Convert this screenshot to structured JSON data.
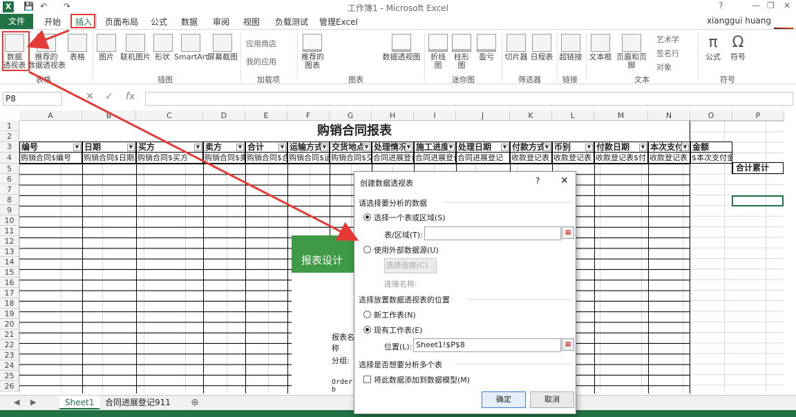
{
  "window": {
    "title": "工作簿1 - Microsoft Excel",
    "help": "?",
    "user": "xianggui huang",
    "min": "—",
    "restore": "❐",
    "close": "✕"
  },
  "qat": {
    "save": "💾",
    "undo": "↶",
    "redo": "↷"
  },
  "tabs": [
    {
      "label": "文件"
    },
    {
      "label": "开始"
    },
    {
      "label": "插入"
    },
    {
      "label": "页面布局"
    },
    {
      "label": "公式"
    },
    {
      "label": "数据"
    },
    {
      "label": "审阅"
    },
    {
      "label": "视图"
    },
    {
      "label": "负载测试"
    },
    {
      "label": "管理Excel"
    }
  ],
  "ribbon": {
    "buttons": [
      {
        "label": "数据\n透视表"
      },
      {
        "label": "推荐的\n数据透视表"
      },
      {
        "label": "表格"
      },
      {
        "label": "图片"
      },
      {
        "label": "联机图片"
      },
      {
        "label": "形状"
      },
      {
        "label": "SmartArt"
      },
      {
        "label": "屏幕截图"
      },
      {
        "label": "推荐的\n图表"
      },
      {
        "label": "数据透视图"
      },
      {
        "label": "折线图"
      },
      {
        "label": "柱形图"
      },
      {
        "label": "盈亏"
      },
      {
        "label": "切片器"
      },
      {
        "label": "日程表"
      },
      {
        "label": "超链接"
      },
      {
        "label": "文本框"
      },
      {
        "label": "页眉和页脚"
      },
      {
        "label": "公式"
      },
      {
        "label": "符号"
      }
    ],
    "small": {
      "store": "应用商店",
      "myapps": "我的应用",
      "art": "艺术字",
      "sign": "签名行",
      "obj": "对象"
    },
    "groups": {
      "table": "表格",
      "illus": "插图",
      "addins": "加载项",
      "charts": "图表",
      "spark": "迷你图",
      "filter": "筛选器",
      "link": "链接",
      "text": "文本",
      "symbol": "符号"
    }
  },
  "formula": {
    "namebox": "P8",
    "cancel": "✕",
    "enter": "✓",
    "fx": "fx"
  },
  "columns": [
    "A",
    "B",
    "C",
    "D",
    "E",
    "F",
    "G",
    "H",
    "I",
    "J",
    "K",
    "L",
    "M",
    "N",
    "O",
    "P"
  ],
  "rows": [
    "1",
    "2",
    "3",
    "4",
    "5",
    "6",
    "7",
    "8",
    "9",
    "10",
    "11",
    "12",
    "13",
    "14",
    "15",
    "16",
    "17",
    "18",
    "19",
    "20",
    "21",
    "22",
    "23",
    "24",
    "25",
    "26"
  ],
  "sheet": {
    "title": "购销合同报表",
    "headers": [
      "编号",
      "日期",
      "买方",
      "卖方",
      "合计",
      "运输方式",
      "交货地点",
      "处理情况",
      "施工进度",
      "处理日期",
      "付款方式",
      "币别",
      "付款日期",
      "本次支付",
      "金额"
    ],
    "fields": [
      "购销合同$编号",
      "购销合同$日期",
      "购销合同$买方",
      "购销合同$卖方",
      "购销合同$合计",
      "购销合同$运输",
      "购销合同$交货",
      "合同进展登记",
      "合同进展登记",
      "合同进展登记",
      "收款登记表",
      "收款登记表",
      "收款登记表$付",
      "收款登记表",
      "$本次支付金额"
    ],
    "total": "合计累计"
  },
  "panel": {
    "title": "报表设计",
    "name": "报表名称",
    "group": "分组:",
    "order": "Order b"
  },
  "sheettabs": [
    {
      "label": "Sheet1"
    },
    {
      "label": "合同进展登记911"
    }
  ],
  "dialog": {
    "title": "创建数据透视表",
    "help": "?",
    "close": "✕",
    "s1": "请选择要分析的数据",
    "r1": "选择一个表或区域(S)",
    "range_label": "表/区域(T):",
    "range_value": "",
    "r2": "使用外部数据源(U)",
    "conn_btn": "选择连接(C)...",
    "conn_name": "连接名称:",
    "s2": "选择放置数据透视表的位置",
    "r3": "新工作表(N)",
    "r4": "现有工作表(E)",
    "loc_label": "位置(L):",
    "loc_value": "Sheet1!$P$8",
    "s3": "选择是否想要分析多个表",
    "chk": "将此数据添加到数据模型(M)",
    "ok": "确定",
    "cancel": "取消"
  }
}
